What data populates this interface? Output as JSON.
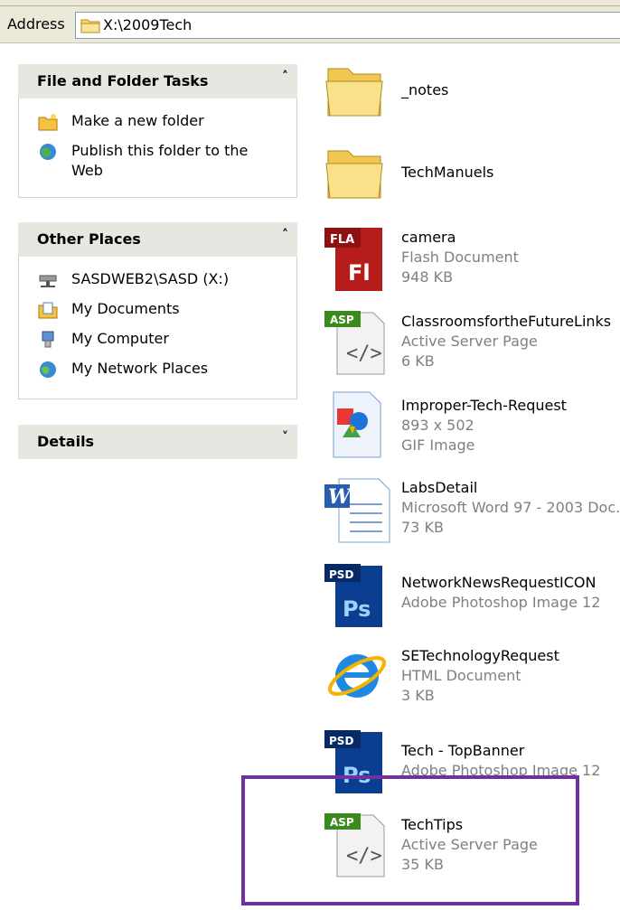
{
  "address": {
    "label": "Address",
    "value": "X:\\2009Tech"
  },
  "panels": {
    "file_tasks": {
      "title": "File and Folder Tasks",
      "items": [
        {
          "label": "Make a new folder",
          "icon": "new-folder-icon"
        },
        {
          "label": "Publish this folder to the Web",
          "icon": "publish-web-icon"
        }
      ]
    },
    "other_places": {
      "title": "Other Places",
      "items": [
        {
          "label": "SASDWEB2\\SASD (X:)",
          "icon": "network-drive-icon"
        },
        {
          "label": "My Documents",
          "icon": "my-documents-icon"
        },
        {
          "label": "My Computer",
          "icon": "my-computer-icon"
        },
        {
          "label": "My Network Places",
          "icon": "network-places-icon"
        }
      ]
    },
    "details": {
      "title": "Details"
    }
  },
  "files": [
    {
      "name": "_notes",
      "type": "",
      "size": "",
      "icon": "folder-icon"
    },
    {
      "name": "TechManuels",
      "type": "",
      "size": "",
      "icon": "folder-icon"
    },
    {
      "name": "camera",
      "type": "Flash Document",
      "size": "948 KB",
      "icon": "fla-file-icon",
      "badge": "FLA",
      "glyph": "Fl"
    },
    {
      "name": "ClassroomsfortheFutureLinks",
      "type": "Active Server Page",
      "size": "6 KB",
      "icon": "asp-file-icon",
      "badge": "ASP"
    },
    {
      "name": "Improper-Tech-Request",
      "type": "893 x 502",
      "size": "GIF Image",
      "icon": "gif-file-icon"
    },
    {
      "name": "LabsDetail",
      "type": "Microsoft Word 97 - 2003 Doc...",
      "size": "73 KB",
      "icon": "word-file-icon",
      "glyph": "W"
    },
    {
      "name": "NetworkNewsRequestICON",
      "type": "Adobe Photoshop Image 12",
      "size": "",
      "icon": "psd-file-icon",
      "badge": "PSD",
      "glyph": "Ps"
    },
    {
      "name": "SETechnologyRequest",
      "type": "HTML Document",
      "size": "3 KB",
      "icon": "html-file-icon",
      "glyph": "e"
    },
    {
      "name": "Tech - TopBanner",
      "type": "Adobe Photoshop Image 12",
      "size": "",
      "icon": "psd-file-icon",
      "badge": "PSD",
      "glyph": "Ps"
    },
    {
      "name": "TechTips",
      "type": "Active Server Page",
      "size": "35 KB",
      "icon": "asp-file-icon",
      "badge": "ASP"
    }
  ],
  "colors": {
    "highlight": "#7030a0",
    "fla": "#b71c1c",
    "psd": "#0b3d91",
    "asp": "#3a8a1e"
  }
}
